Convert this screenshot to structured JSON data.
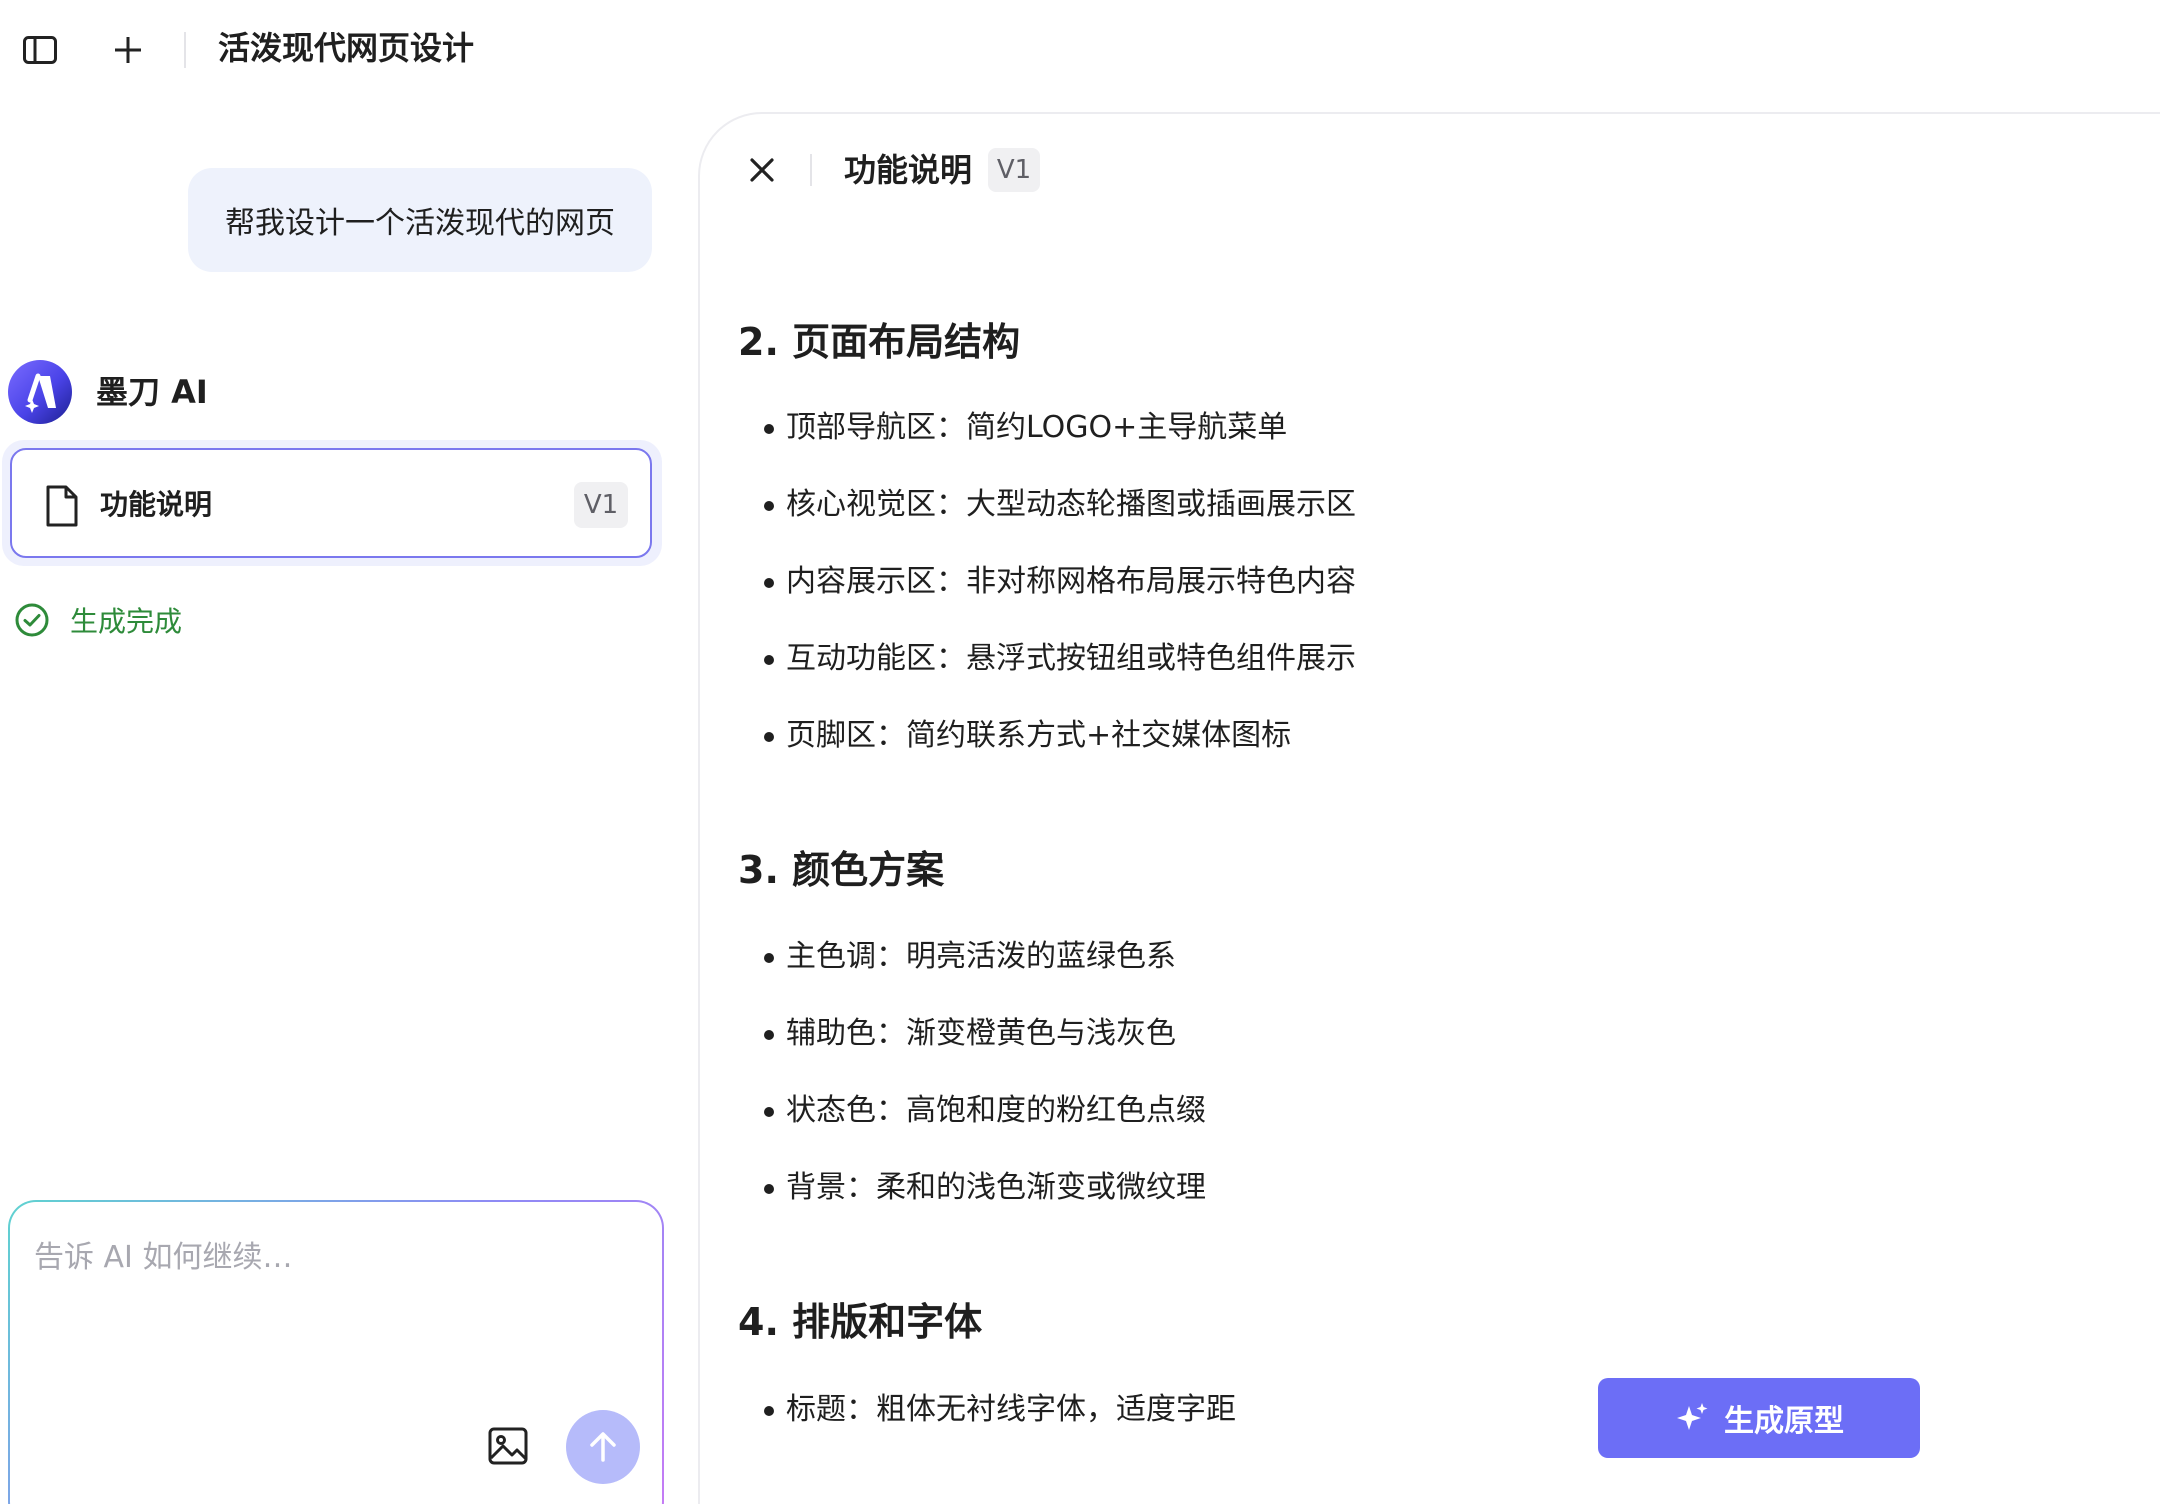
{
  "topbar": {
    "title": "活泼现代网页设计"
  },
  "chat": {
    "user_message": "帮我设计一个活泼现代的网页",
    "ai_name": "墨刀 AI",
    "doc_card": {
      "label": "功能说明",
      "version": "V1"
    },
    "status": "生成完成",
    "input_placeholder": "告诉 AI 如何继续…"
  },
  "panel": {
    "title": "功能说明",
    "version": "V1",
    "sections": [
      {
        "heading": "2. 页面布局结构",
        "items": [
          "顶部导航区：简约LOGO+主导航菜单",
          "核心视觉区：大型动态轮播图或插画展示区",
          "内容展示区：非对称网格布局展示特色内容",
          "互动功能区：悬浮式按钮组或特色组件展示",
          "页脚区：简约联系方式+社交媒体图标"
        ]
      },
      {
        "heading": "3. 颜色方案",
        "items": [
          "主色调：明亮活泼的蓝绿色系",
          "辅助色：渐变橙黄色与浅灰色",
          "状态色：高饱和度的粉红色点缀",
          "背景：柔和的浅色渐变或微纹理"
        ]
      },
      {
        "heading": "4. 排版和字体",
        "items": [
          "标题：粗体无衬线字体，适度字距"
        ]
      }
    ],
    "generate_button": "生成原型"
  },
  "colors": {
    "accent": "#6c6ef6",
    "success": "#2e8b3a",
    "user_bubble": "#eef2fc"
  }
}
